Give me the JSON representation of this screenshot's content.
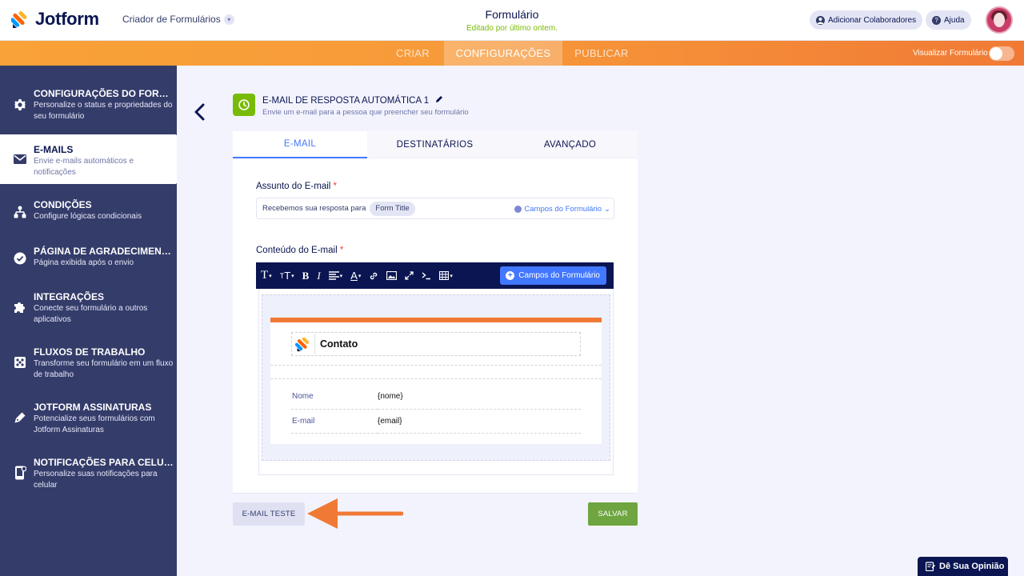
{
  "header": {
    "brand": "Jotform",
    "builder_label": "Criador de Formulários",
    "form_title": "Formulário",
    "form_subtitle": "Editado por último ontem.",
    "collaborators_label": "Adicionar Colaboradores",
    "help_label": "Ajuda"
  },
  "nav": {
    "tabs": [
      {
        "label": "CRIAR",
        "active": false
      },
      {
        "label": "CONFIGURAÇÕES",
        "active": true
      },
      {
        "label": "PUBLICAR",
        "active": false
      }
    ],
    "preview_label": "Visualizar Formulário",
    "preview_on": false
  },
  "sidebar": {
    "items": [
      {
        "icon": "gear-icon",
        "title": "CONFIGURAÇÕES DO FORMULÁRIO",
        "desc": "Personalize o status e propriedades do seu formulário",
        "active": false
      },
      {
        "icon": "envelope-icon",
        "title": "E-MAILS",
        "desc": "Envie e-mails automáticos e notificações",
        "active": true
      },
      {
        "icon": "hierarchy-icon",
        "title": "CONDIÇÕES",
        "desc": "Configure lógicas condicionais",
        "active": false
      },
      {
        "icon": "check-circle-icon",
        "title": "PÁGINA DE AGRADECIMENTO",
        "desc": "Página exibida após o envio",
        "active": false
      },
      {
        "icon": "puzzle-icon",
        "title": "INTEGRAÇÕES",
        "desc": "Conecte seu formulário a outros aplicativos",
        "active": false
      },
      {
        "icon": "workflow-icon",
        "title": "FLUXOS DE TRABALHO",
        "desc": "Transforme seu formulário em um fluxo de trabalho",
        "active": false
      },
      {
        "icon": "pen-icon",
        "title": "JOTFORM ASSINATURAS",
        "desc": "Potencialize seus formulários com Jotform Assinaturas",
        "active": false
      },
      {
        "icon": "mobile-icon",
        "title": "NOTIFICAÇÕES PARA CELULAR",
        "desc": "Personalize suas notificações para celular",
        "active": false
      }
    ]
  },
  "panel": {
    "title": "E-MAIL DE RESPOSTA AUTOMÁTICA 1",
    "subtitle": "Envie um e-mail para a pessoa que preencher seu formulário",
    "tabs": [
      {
        "label": "E-MAIL",
        "active": true
      },
      {
        "label": "DESTINATÁRIOS",
        "active": false
      },
      {
        "label": "AVANÇADO",
        "active": false
      }
    ],
    "subject_label": "Assunto do E-mail",
    "subject_text": "Recebemos sua resposta para",
    "subject_chip": "Form Title",
    "form_fields_label": "Campos do Formulário",
    "content_label": "Conteúdo do E-mail",
    "required_mark": "*",
    "toolbar_button": "Campos do Formulário",
    "email_preview": {
      "heading": "Contato",
      "rows": [
        {
          "key": "Nome",
          "value": "{nome}"
        },
        {
          "key": "E-mail",
          "value": "{email}"
        }
      ]
    },
    "test_button": "E-MAIL TESTE",
    "save_button": "SALVAR"
  },
  "feedback_label": "Dê Sua Opinião",
  "colors": {
    "navy": "#0a1551",
    "sidebar": "#343c6a",
    "orange": "#f07a35",
    "blue": "#4277ff",
    "green": "#78bb07",
    "save_green": "#6ea540"
  }
}
